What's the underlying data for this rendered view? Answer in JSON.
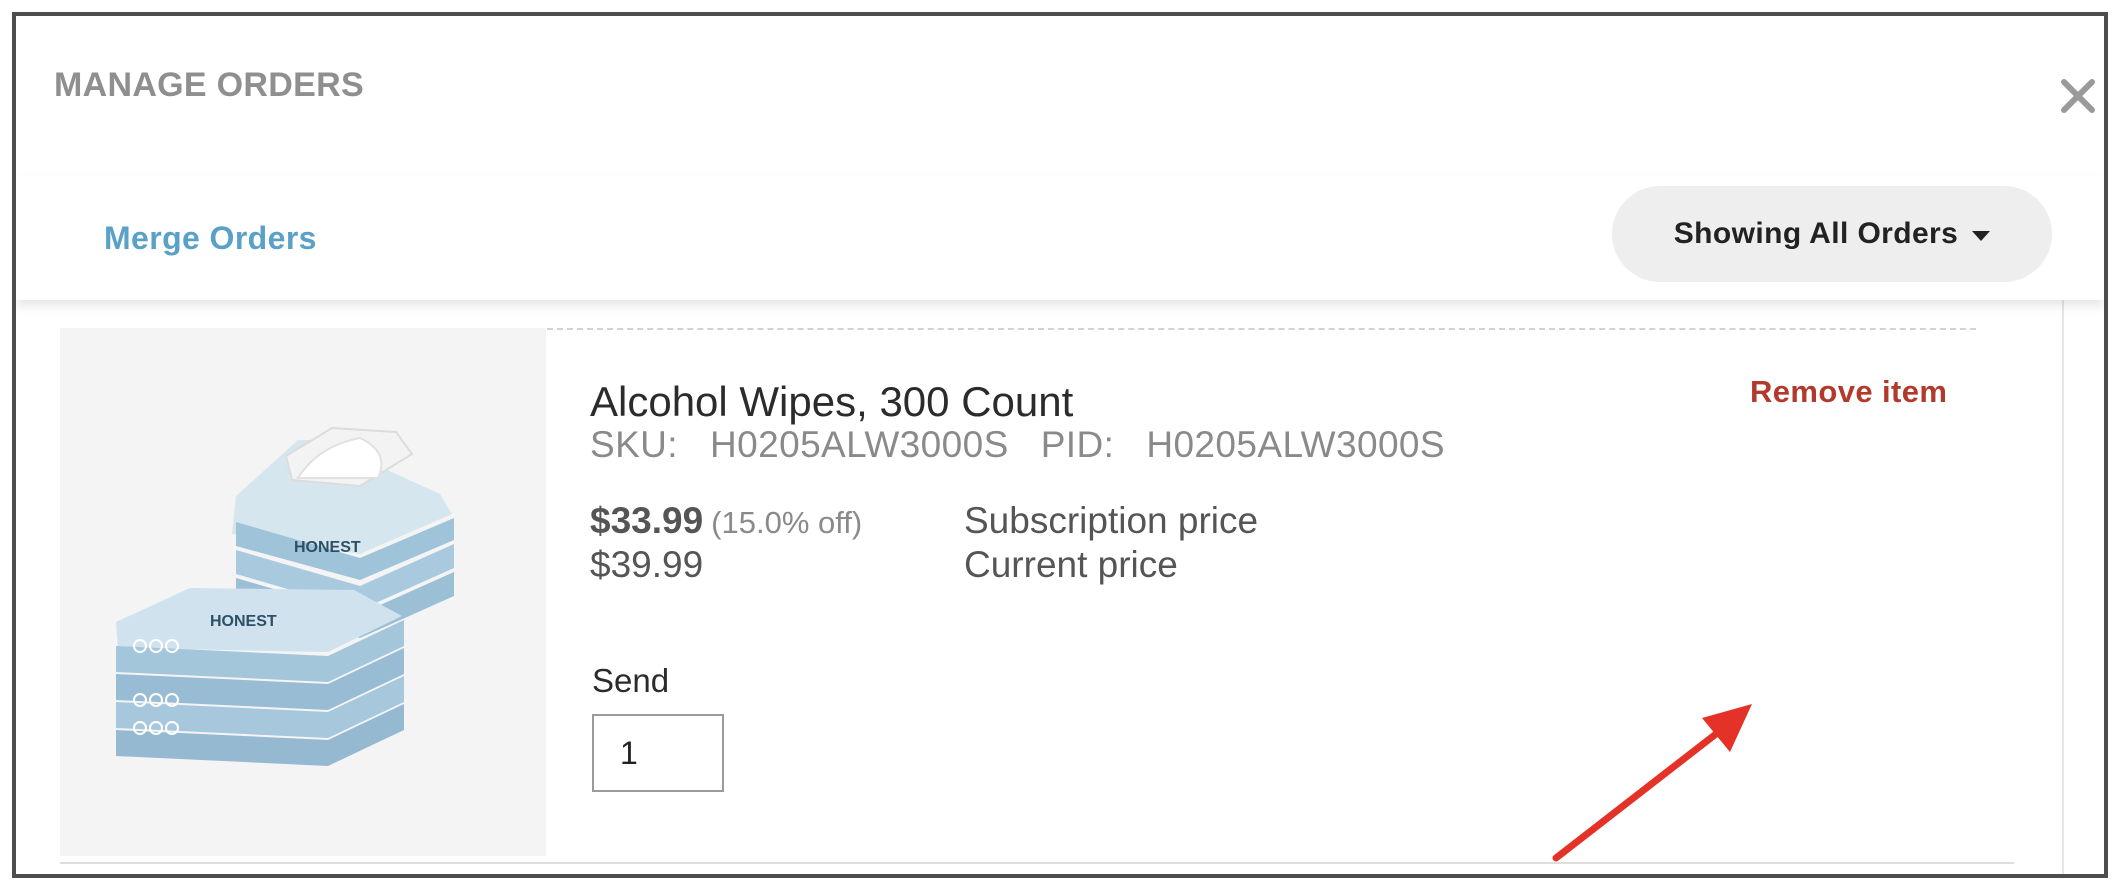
{
  "modal": {
    "title": "MANAGE ORDERS",
    "close_icon": "close-icon"
  },
  "toolbar": {
    "merge_label": "Merge Orders",
    "filter_label": "Showing All Orders",
    "filter_icon": "caret-down-icon"
  },
  "item": {
    "image_alt": "HONEST alcohol wipes packs",
    "image_brand": "HONEST",
    "name": "Alcohol Wipes, 300 Count",
    "sku_label": "SKU:",
    "sku": "H0205ALW3000S",
    "pid_label": "PID:",
    "pid": "H0205ALW3000S",
    "subscription_price": "$33.99",
    "discount": "(15.0% off)",
    "subscription_price_label": "Subscription price",
    "current_price": "$39.99",
    "current_price_label": "Current price",
    "remove_label": "Remove item",
    "send_label": "Send",
    "quantity": "1"
  },
  "colors": {
    "accent_link": "#5aa1c7",
    "remove": "#b23a2c",
    "annotation_arrow": "#e53228"
  }
}
